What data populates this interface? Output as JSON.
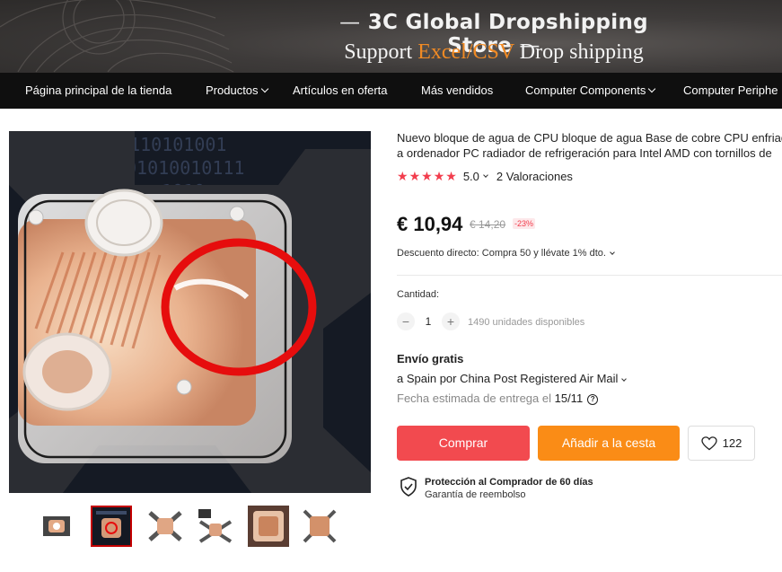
{
  "banner": {
    "title": "3C Global Dropshipping Store",
    "dash": "—",
    "subtitle_prefix": "Support ",
    "subtitle_accent": "Excel/CSV",
    "subtitle_suffix": " Drop shipping"
  },
  "nav": {
    "items": [
      {
        "label": "Página principal de la tienda",
        "has_dropdown": false
      },
      {
        "label": "Productos",
        "has_dropdown": true
      },
      {
        "label": "Artículos en oferta",
        "has_dropdown": false
      },
      {
        "label": "Más vendidos",
        "has_dropdown": false
      },
      {
        "label": "Computer Components",
        "has_dropdown": true
      },
      {
        "label": "Computer Periphe",
        "has_dropdown": false
      }
    ]
  },
  "product": {
    "title_line1": "Nuevo bloque de agua de CPU bloque de agua Base de cobre CPU enfriad",
    "title_line2": "a ordenador PC radiador de refrigeración para Intel AMD con tornillos de",
    "rating": {
      "stars": 5,
      "score": "5.0",
      "reviews_label": "2 Valoraciones"
    },
    "price": "€ 10,94",
    "old_price": "€ 14,20",
    "discount": "-23%",
    "direct_discount": "Descuento directo: Compra 50 y llévate 1% dto.",
    "quantity": {
      "label": "Cantidad:",
      "minus": "−",
      "plus": "+",
      "value": "1",
      "available": "1490 unidades disponibles"
    },
    "shipping": {
      "title": "Envío gratis",
      "route": "a Spain por China Post Registered Air Mail",
      "date_prefix": "Fecha estimada de entrega el ",
      "date": "15/11",
      "help_icon": "?"
    },
    "buttons": {
      "buy": "Comprar",
      "add_to_cart": "Añadir a la cesta",
      "wishlist_count": "122"
    },
    "protection": {
      "title": "Protección al Comprador de 60 días",
      "subtitle": "Garantía de reembolso"
    }
  },
  "icons": {
    "star": "star-icon",
    "heart": "heart-icon",
    "shield": "shield-check-icon",
    "help": "question-circle-icon"
  },
  "colors": {
    "accent_red": "#f24a4f",
    "accent_orange": "#fa8c16",
    "star": "#f23d4d",
    "nav_bg": "#0f0f0f",
    "banner_accent": "#f08a24"
  },
  "gallery": {
    "thumbnail_count": 6,
    "active_index": 1
  }
}
